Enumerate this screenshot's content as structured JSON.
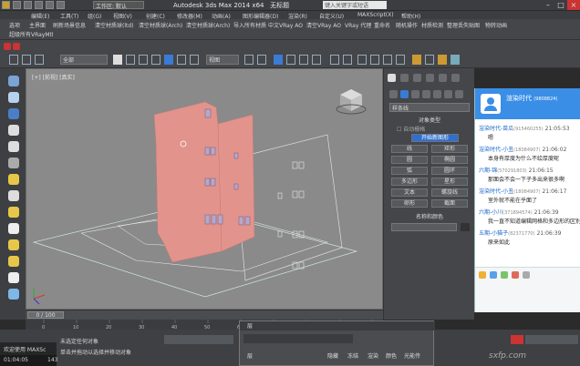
{
  "title_bar": {
    "title": "Autodesk 3ds Max  2014 x64",
    "untitled": "无标题",
    "workspace": "工作区: 默认",
    "search_placeholder": "键入关键字或短语"
  },
  "menu": [
    "编辑(E)",
    "工具(T)",
    "组(G)",
    "视图(V)",
    "创建(C)",
    "修改器(M)",
    "动画(A)",
    "图形编辑器(D)",
    "渲染(R)",
    "自定义(U)",
    "MAXScript(X)",
    "帮助(H)"
  ],
  "plugin_bar": {
    "row1": [
      "选项",
      "主界面",
      "刷新场景信息",
      "清空材质球(ltd)",
      "清空材质球(Arch)",
      "清空材质球(Arch)",
      "导入所有材质",
      "中文VRay AO",
      "清空VRay AO",
      "VRay 代理",
      "重命名",
      "随机操作",
      "材质检测",
      "整理丢失贴图",
      "物转动画"
    ],
    "row2": [
      "超级所有VRayMtl"
    ]
  },
  "toolbar": {
    "selection_filter": "全部",
    "view_dropdown": "视图"
  },
  "viewport": {
    "label": "[+] [前视] [真实]",
    "bg": "#8a8a8a",
    "building_color": "#e2938c"
  },
  "timeline": {
    "frame": "0 / 100",
    "ticks": [
      "0",
      "10",
      "20",
      "30",
      "40",
      "50",
      "60",
      "70",
      "80",
      "90",
      "100"
    ]
  },
  "status": {
    "welcome": "欢迎使用 MAXSc",
    "no_selection": "未选定任何对象",
    "hint": "单击并拖动以选择并移动对象",
    "time": "01:04:05",
    "count": "143"
  },
  "command_panel": {
    "dropdown": "样条线",
    "object_type_header": "对象类型",
    "auto_grid": "自动栅格",
    "start_new_shape": "开始新图形",
    "buttons": [
      [
        "线",
        "矩形"
      ],
      [
        "圆",
        "椭圆"
      ],
      [
        "弧",
        "圆环"
      ],
      [
        "多边形",
        "星形"
      ],
      [
        "文本",
        "螺旋线"
      ],
      [
        "卵形",
        "截面"
      ]
    ],
    "name_color_header": "名称和颜色"
  },
  "chat": {
    "title": "渲染时代",
    "title_id": "(9808824)",
    "messages": [
      {
        "sender": "渲染时代-苗瓜",
        "id": "(915460255)",
        "time": "21:05:53",
        "text": "嗯"
      },
      {
        "sender": "渲染时代-小丑",
        "id": "(18084907)",
        "time": "21:06:02",
        "text": "本身有厚度为什么不绘厚度呢"
      },
      {
        "sender": "六期-锦",
        "id": "(570291803)",
        "time": "21:06:15",
        "text": "那面会不会一下子多出来很多啊"
      },
      {
        "sender": "渲染时代-小丑",
        "id": "(18084907)",
        "time": "21:06:17",
        "text": "室外就不能在乎面了"
      },
      {
        "sender": "六期-小川",
        "id": "(371894574)",
        "time": "21:06:39",
        "text": "我一直不知道编辑网格和多边形的区别"
      },
      {
        "sender": "五期-小猫子",
        "id": "(82371770)",
        "time": "21:06:39",
        "text": "原来如此"
      }
    ]
  },
  "layer_dialog": {
    "title": "层",
    "columns": [
      "层",
      "隐藏",
      "冻结",
      "渲染",
      "颜色",
      "光能传"
    ]
  },
  "watermark": "sxfp.com"
}
